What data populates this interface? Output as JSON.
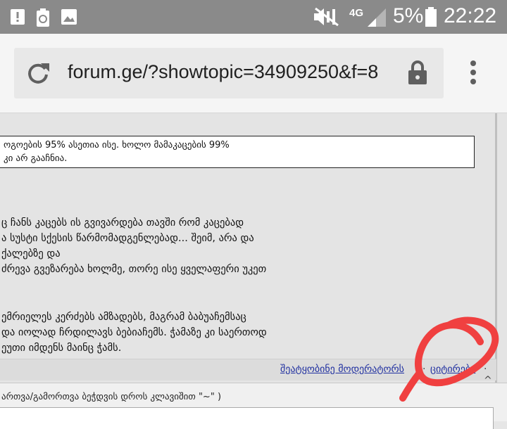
{
  "status_bar": {
    "network": "4G",
    "battery": "5%",
    "time": "22:22",
    "icons": [
      "alert-icon",
      "recycle-icon",
      "image-icon",
      "mute-icon",
      "signal-icon",
      "battery-icon"
    ]
  },
  "browser": {
    "url": "forum.ge/?showtopic=34909250&f=8",
    "icons": [
      "reload-icon",
      "lock-icon",
      "menu-icon"
    ]
  },
  "post": {
    "quote_lines": [
      "ოგოების 95% ასეთია ისე. ხოლო მამაკაცების 99%",
      "კი არ გააჩნია."
    ],
    "body_lines": [
      "ც ჩანს კაცებს ის გვივარდება თავში რომ კაცებად",
      "ა სუსტი სქესის წარმომადგენლებად... შეიმ, არა და",
      " ქალებზე და",
      "ძრევა გვეზარება ხოლმე, თორე ისე ყველაფერი უკეთ",
      "ემრიელეს კერძებს ამზადებს, მაგრამ ბაბუაჩემსაც",
      " და იოლად ჩრდილავს ბებიაჩემს. ჭამაზე კი საერთოდ",
      "ეუთი იმდენს მაინც ჭამს."
    ]
  },
  "footer": {
    "report_link": "შეატყობინე მოდერატორს",
    "separator": "·",
    "quote_link": "ციტირება",
    "trailing": "· ^"
  },
  "reply": {
    "hint": "ართვა/გამორთვა ბეჭდვის დროს კლავიშით \"~\" )"
  },
  "annotation": {
    "color": "#f04040"
  }
}
